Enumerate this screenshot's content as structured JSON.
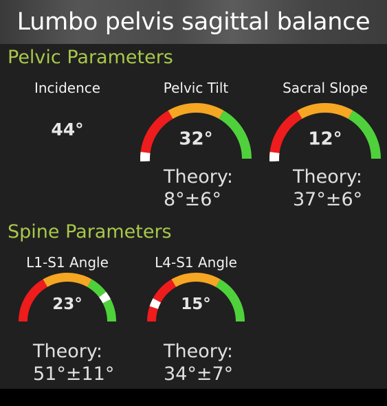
{
  "header": {
    "title": "Lumbo pelvis sagittal balance"
  },
  "pelvic": {
    "section_title": "Pelvic Parameters",
    "incidence": {
      "label": "Incidence",
      "value": "44°"
    },
    "pelvic_tilt": {
      "label": "Pelvic Tilt",
      "value": "32°",
      "theory_label": "Theory:",
      "theory_value": "8°±6°",
      "marker_level": 0.0
    },
    "sacral_slope": {
      "label": "Sacral Slope",
      "value": "12°",
      "theory_label": "Theory:",
      "theory_value": "37°±6°",
      "marker_level": 0.0
    }
  },
  "spine": {
    "section_title": "Spine Parameters",
    "l1s1": {
      "label": "L1-S1 Angle",
      "value": "23°",
      "theory_label": "Theory:",
      "theory_value": "51°±11°",
      "marker_level": 0.82
    },
    "l4s1": {
      "label": "L4-S1 Angle",
      "value": "15°",
      "theory_label": "Theory:",
      "theory_value": "34°±7°",
      "marker_level": 0.13
    }
  },
  "colors": {
    "red": "#ee1c1c",
    "orange": "#f5a623",
    "green": "#4fd13c",
    "marker": "#ffffff",
    "section": "#a8c84a"
  }
}
